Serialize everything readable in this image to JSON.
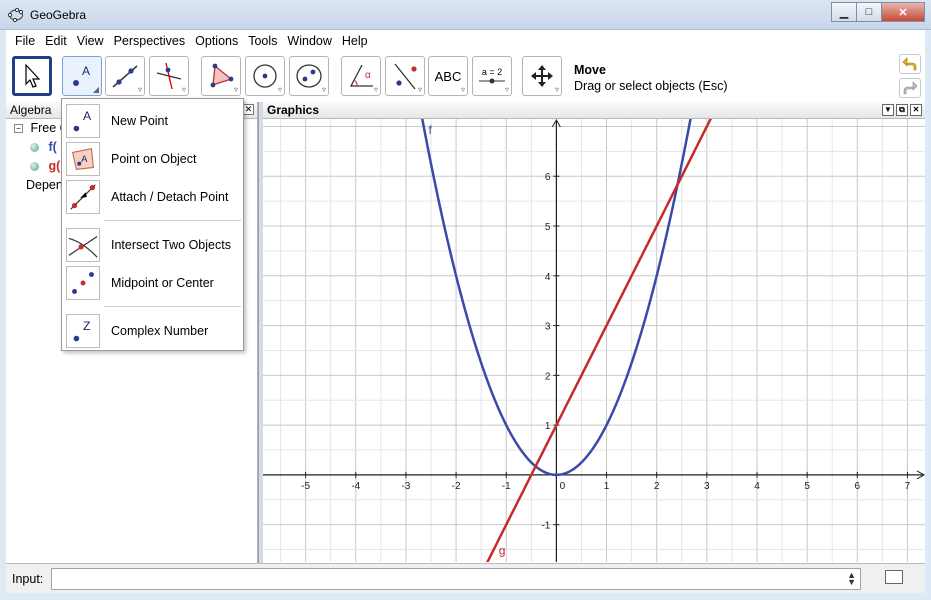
{
  "window": {
    "title": "GeoGebra"
  },
  "menubar": {
    "items": [
      "File",
      "Edit",
      "View",
      "Perspectives",
      "Options",
      "Tools",
      "Window",
      "Help"
    ]
  },
  "toolbar": {
    "active_tool_name": "Move",
    "active_tool_hint": "Drag or select objects (Esc)",
    "tools": [
      "move",
      "point",
      "line",
      "perpendicular",
      "polygon",
      "circle",
      "conic",
      "angle",
      "reflect",
      "text",
      "slider",
      "move-graphics-view"
    ],
    "text_tool_label": "ABC",
    "slider_tool_label": "a = 2"
  },
  "algebra": {
    "title": "Algebra",
    "free_objects_label": "Free C",
    "f_label": "f(",
    "g_label": "g(",
    "dependent_label": "Depen"
  },
  "graphics": {
    "title": "Graphics",
    "curve_f_label": "f",
    "curve_g_label": "g"
  },
  "dropdown": {
    "items": [
      {
        "label": "New Point",
        "icon": "new-point-icon"
      },
      {
        "label": "Point on Object",
        "icon": "point-on-object-icon"
      },
      {
        "label": "Attach / Detach Point",
        "icon": "attach-detach-point-icon"
      },
      {
        "label": "Intersect Two Objects",
        "icon": "intersect-icon"
      },
      {
        "label": "Midpoint or Center",
        "icon": "midpoint-icon"
      },
      {
        "label": "Complex Number",
        "icon": "complex-number-icon"
      }
    ]
  },
  "input_bar": {
    "label": "Input:",
    "value": ""
  },
  "chart_data": {
    "type": "line",
    "x_ticks": [
      -5,
      -4,
      -3,
      -2,
      -1,
      0,
      1,
      2,
      3,
      4,
      5,
      6,
      7
    ],
    "y_ticks": [
      -1,
      0,
      1,
      2,
      3,
      4,
      5,
      6
    ],
    "xlim": [
      -5.85,
      7.35
    ],
    "ylim": [
      -1.75,
      7.15
    ],
    "series": [
      {
        "name": "f",
        "function": "x^2",
        "color": "#3a4aa8"
      },
      {
        "name": "g",
        "function": "2x+1",
        "color": "#c52b2b"
      }
    ],
    "grid": true
  }
}
